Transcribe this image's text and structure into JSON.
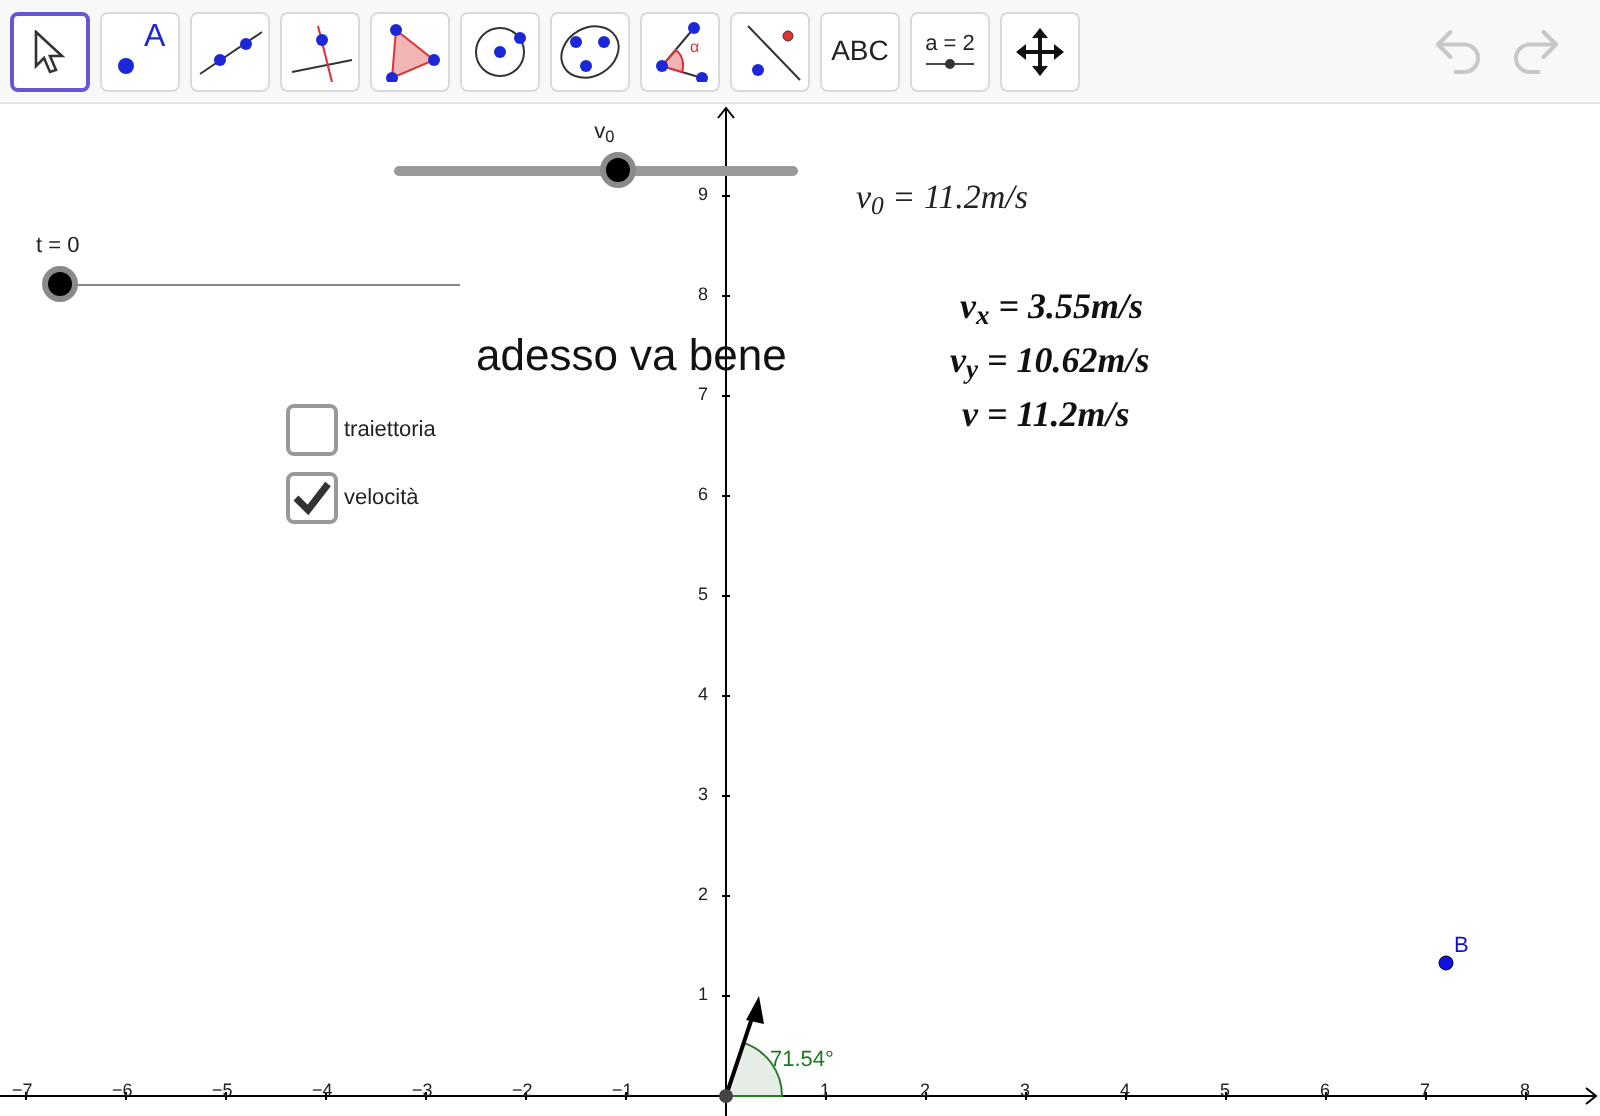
{
  "toolbar": {
    "tools": [
      {
        "kind": "move",
        "selected": true
      },
      {
        "kind": "point",
        "label": "A",
        "selected": false
      },
      {
        "kind": "line",
        "selected": false
      },
      {
        "kind": "perpendicular",
        "selected": false
      },
      {
        "kind": "polygon",
        "selected": false
      },
      {
        "kind": "circle",
        "selected": false
      },
      {
        "kind": "conic",
        "selected": false
      },
      {
        "kind": "angle",
        "label": "α",
        "selected": false
      },
      {
        "kind": "reflect",
        "selected": false
      },
      {
        "kind": "text",
        "label": "ABC",
        "selected": false
      },
      {
        "kind": "slider",
        "label": "a = 2",
        "selected": false
      },
      {
        "kind": "pan",
        "selected": false
      }
    ],
    "undo": {
      "disabled": true
    },
    "redo": {
      "disabled": true
    }
  },
  "sliders": [
    {
      "label": "v$_{0}$",
      "level": 0.555,
      "kind": "thick"
    },
    {
      "label": "t = 0",
      "level": 0,
      "kind": "thin"
    }
  ],
  "texts": [
    {
      "kind": "formula",
      "text": "v$_{0}$ = 11.2m/s"
    },
    {
      "kind": "bold-formula",
      "text": "v$_{x}$ = 3.55m/s"
    },
    {
      "kind": "bold-formula",
      "text": "v$_{y}$ = 10.62m/s"
    },
    {
      "kind": "bold-formula",
      "text": "v = 11.2m/s"
    },
    {
      "kind": "caption",
      "text": "adesso va bene"
    }
  ],
  "checkboxes": [
    {
      "label": "traiettoria",
      "checked": false
    },
    {
      "label": "velocità",
      "checked": true
    }
  ],
  "graphics": {
    "x_axis_labels": [
      "−7",
      "−6",
      "−5",
      "−4",
      "−3",
      "−2",
      "−1",
      "1",
      "2",
      "3",
      "4",
      "5",
      "6",
      "7",
      "8"
    ],
    "y_axis_labels": [
      "9",
      "8",
      "7",
      "6",
      "5",
      "4",
      "3",
      "2",
      "1"
    ],
    "angle_label": "71.54°",
    "point_label": "B"
  }
}
